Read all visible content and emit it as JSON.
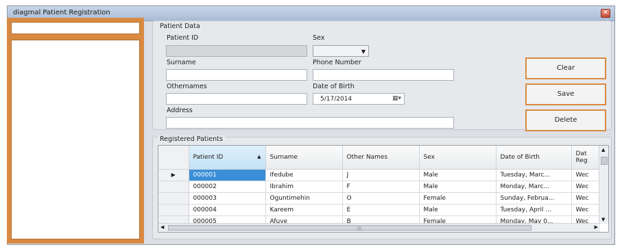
{
  "window": {
    "title": "diagmal Patient Registration",
    "close_glyph": "✕"
  },
  "patient_data": {
    "legend": "Patient Data",
    "labels": {
      "patient_id": "Patient ID",
      "sex": "Sex",
      "surname": "Surname",
      "phone": "Phone Number",
      "othernames": "Othernames",
      "dob": "Date of Birth",
      "address": "Address"
    },
    "values": {
      "patient_id": "",
      "sex": "",
      "surname": "",
      "phone": "",
      "othernames": "",
      "dob": "5/17/2014",
      "address": ""
    }
  },
  "buttons": {
    "clear": "Clear",
    "save": "Save",
    "delete": "Delete"
  },
  "registered": {
    "legend": "Registered Patients",
    "columns": [
      "Patient ID",
      "Surname",
      "Other Names",
      "Sex",
      "Date of Birth",
      "Dat Reg"
    ],
    "sort_glyph": "▲",
    "current_row_marker": "▶",
    "rows": [
      [
        "000001",
        "Ifedube",
        "J",
        "Male",
        "Tuesday, Marc...",
        "Wec"
      ],
      [
        "000002",
        "Ibrahim",
        "F",
        "Male",
        "Monday, Marc...",
        "Wec"
      ],
      [
        "000003",
        "Oguntimehin",
        "O",
        "Female",
        "Sunday, Februa...",
        "Wec"
      ],
      [
        "000004",
        "Kareem",
        "E",
        "Male",
        "Tuesday, April ...",
        "Wec"
      ],
      [
        "000005",
        "Afuye",
        "B",
        "Female",
        "Monday, May 0...",
        "Wec"
      ]
    ]
  }
}
